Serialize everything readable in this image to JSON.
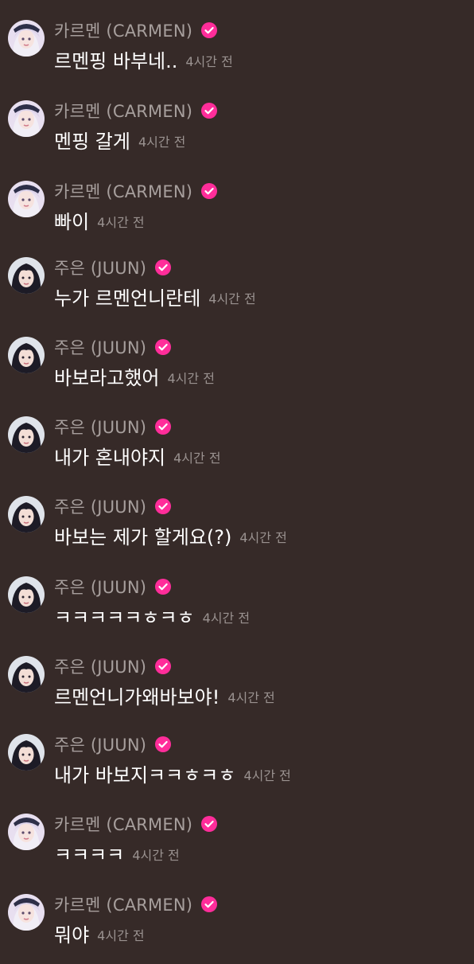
{
  "colors": {
    "background": "#362a28",
    "name_text": "#a79f9d",
    "message_text": "#ffffff",
    "time_text": "#9a9290",
    "verified_badge": "#ff2d9a"
  },
  "messages": [
    {
      "author": "카르멘 (CARMEN)",
      "avatar": "carmen-avatar",
      "text": "르멘핑 바부네..",
      "time": "4시간 전"
    },
    {
      "author": "카르멘 (CARMEN)",
      "avatar": "carmen-avatar",
      "text": "멘핑 갈게",
      "time": "4시간 전"
    },
    {
      "author": "카르멘 (CARMEN)",
      "avatar": "carmen-avatar",
      "text": "빠이",
      "time": "4시간 전"
    },
    {
      "author": "주은 (JUUN)",
      "avatar": "juun-avatar",
      "text": "누가 르멘언니란테",
      "time": "4시간 전"
    },
    {
      "author": "주은 (JUUN)",
      "avatar": "juun-avatar",
      "text": "바보라고했어",
      "time": "4시간 전"
    },
    {
      "author": "주은 (JUUN)",
      "avatar": "juun-avatar",
      "text": "내가 혼내야지",
      "time": "4시간 전"
    },
    {
      "author": "주은 (JUUN)",
      "avatar": "juun-avatar",
      "text": "바보는 제가 할게요(?)",
      "time": "4시간 전"
    },
    {
      "author": "주은 (JUUN)",
      "avatar": "juun-avatar",
      "text": "ㅋㅋㅋㅋㅋㅎㅋㅎ",
      "time": "4시간 전"
    },
    {
      "author": "주은 (JUUN)",
      "avatar": "juun-avatar",
      "text": "르멘언니가왜바보야!",
      "time": "4시간 전"
    },
    {
      "author": "주은 (JUUN)",
      "avatar": "juun-avatar",
      "text": "내가 바보지ㅋㅋㅎㅋㅎ",
      "time": "4시간 전"
    },
    {
      "author": "카르멘 (CARMEN)",
      "avatar": "carmen-avatar",
      "text": "ㅋㅋㅋㅋ",
      "time": "4시간 전"
    },
    {
      "author": "카르멘 (CARMEN)",
      "avatar": "carmen-avatar",
      "text": "뭐야",
      "time": "4시간 전"
    }
  ]
}
